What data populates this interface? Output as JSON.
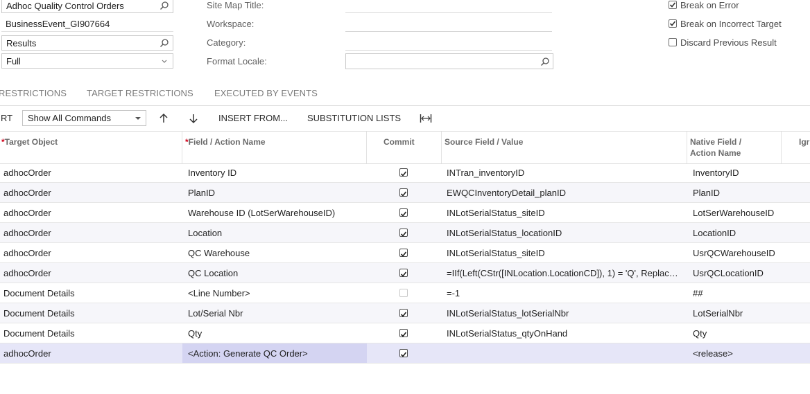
{
  "form": {
    "screen_name": "Adhoc Quality Control Orders",
    "event_name": "BusinessEvent_GI907664",
    "results": "Results",
    "mode": "Full",
    "site_map_title_label": "Site Map Title:",
    "workspace_label": "Workspace:",
    "category_label": "Category:",
    "format_locale_label": "Format Locale:",
    "format_locale_value": ""
  },
  "options": {
    "break_on_error": {
      "label": "Break on Error",
      "checked": true
    },
    "break_on_incorrect_target": {
      "label": "Break on Incorrect Target",
      "checked": true
    },
    "discard_previous_result": {
      "label": "Discard Previous Result",
      "checked": false
    }
  },
  "tabs": [
    "RESTRICTIONS",
    "TARGET RESTRICTIONS",
    "EXECUTED BY EVENTS"
  ],
  "toolbar": {
    "insert_partial": "RT",
    "commands_select": "Show All Commands",
    "insert_from": "INSERT FROM...",
    "substitution_lists": "SUBSTITUTION LISTS"
  },
  "grid": {
    "headers": {
      "target_object": "Target Object",
      "field_action": "Field / Action Name",
      "commit": "Commit",
      "source": "Source Field / Value",
      "native_line1": "Native Field /",
      "native_line2": "Action Name",
      "ignore_partial": "Igr"
    },
    "rows": [
      {
        "target": "adhocOrder",
        "field": "Inventory ID",
        "commit": true,
        "source": "INTran_inventoryID",
        "native": "InventoryID"
      },
      {
        "target": "adhocOrder",
        "field": "PlanID",
        "commit": true,
        "source": "EWQCInventoryDetail_planID",
        "native": "PlanID"
      },
      {
        "target": "adhocOrder",
        "field": "Warehouse ID (LotSerWarehouseID)",
        "commit": true,
        "source": "INLotSerialStatus_siteID",
        "native": "LotSerWarehouseID"
      },
      {
        "target": "adhocOrder",
        "field": "Location",
        "commit": true,
        "source": "INLotSerialStatus_locationID",
        "native": "LocationID"
      },
      {
        "target": "adhocOrder",
        "field": "QC Warehouse",
        "commit": true,
        "source": "INLotSerialStatus_siteID",
        "native": "UsrQCWarehouseID"
      },
      {
        "target": "adhocOrder",
        "field": "QC Location",
        "commit": true,
        "source": "=IIf(Left(CStr([INLocation.LocationCD]), 1) = 'Q', Replac…",
        "native": "UsrQCLocationID"
      },
      {
        "target": "Document Details",
        "field": "<Line Number>",
        "commit": false,
        "source": "=-1",
        "native": "##"
      },
      {
        "target": "Document Details",
        "field": "Lot/Serial Nbr",
        "commit": true,
        "source": "INLotSerialStatus_lotSerialNbr",
        "native": "LotSerialNbr"
      },
      {
        "target": "Document Details",
        "field": "Qty",
        "commit": true,
        "source": "INLotSerialStatus_qtyOnHand",
        "native": "Qty"
      },
      {
        "target": "adhocOrder",
        "field": "<Action: Generate QC Order>",
        "commit": true,
        "source": "",
        "native": "<release>"
      }
    ]
  }
}
